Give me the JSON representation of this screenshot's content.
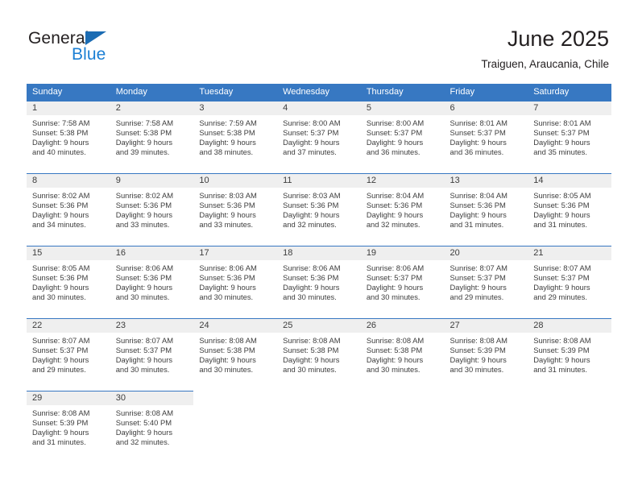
{
  "brand": {
    "name_part1": "General",
    "name_part2": "Blue",
    "triangle_icon": "triangle-icon",
    "colors": {
      "dark": "#231f20",
      "blue": "#1b7fd4",
      "triangle": "#1b6cb3"
    }
  },
  "header": {
    "title": "June 2025",
    "subtitle": "Traiguen, Araucania, Chile"
  },
  "calendar": {
    "accent_color": "#3778c2",
    "daynum_band_color": "#efefef",
    "weekdays": [
      "Sunday",
      "Monday",
      "Tuesday",
      "Wednesday",
      "Thursday",
      "Friday",
      "Saturday"
    ],
    "weeks": [
      [
        {
          "day": "1",
          "sunrise": "Sunrise: 7:58 AM",
          "sunset": "Sunset: 5:38 PM",
          "daylight1": "Daylight: 9 hours",
          "daylight2": "and 40 minutes."
        },
        {
          "day": "2",
          "sunrise": "Sunrise: 7:58 AM",
          "sunset": "Sunset: 5:38 PM",
          "daylight1": "Daylight: 9 hours",
          "daylight2": "and 39 minutes."
        },
        {
          "day": "3",
          "sunrise": "Sunrise: 7:59 AM",
          "sunset": "Sunset: 5:38 PM",
          "daylight1": "Daylight: 9 hours",
          "daylight2": "and 38 minutes."
        },
        {
          "day": "4",
          "sunrise": "Sunrise: 8:00 AM",
          "sunset": "Sunset: 5:37 PM",
          "daylight1": "Daylight: 9 hours",
          "daylight2": "and 37 minutes."
        },
        {
          "day": "5",
          "sunrise": "Sunrise: 8:00 AM",
          "sunset": "Sunset: 5:37 PM",
          "daylight1": "Daylight: 9 hours",
          "daylight2": "and 36 minutes."
        },
        {
          "day": "6",
          "sunrise": "Sunrise: 8:01 AM",
          "sunset": "Sunset: 5:37 PM",
          "daylight1": "Daylight: 9 hours",
          "daylight2": "and 36 minutes."
        },
        {
          "day": "7",
          "sunrise": "Sunrise: 8:01 AM",
          "sunset": "Sunset: 5:37 PM",
          "daylight1": "Daylight: 9 hours",
          "daylight2": "and 35 minutes."
        }
      ],
      [
        {
          "day": "8",
          "sunrise": "Sunrise: 8:02 AM",
          "sunset": "Sunset: 5:36 PM",
          "daylight1": "Daylight: 9 hours",
          "daylight2": "and 34 minutes."
        },
        {
          "day": "9",
          "sunrise": "Sunrise: 8:02 AM",
          "sunset": "Sunset: 5:36 PM",
          "daylight1": "Daylight: 9 hours",
          "daylight2": "and 33 minutes."
        },
        {
          "day": "10",
          "sunrise": "Sunrise: 8:03 AM",
          "sunset": "Sunset: 5:36 PM",
          "daylight1": "Daylight: 9 hours",
          "daylight2": "and 33 minutes."
        },
        {
          "day": "11",
          "sunrise": "Sunrise: 8:03 AM",
          "sunset": "Sunset: 5:36 PM",
          "daylight1": "Daylight: 9 hours",
          "daylight2": "and 32 minutes."
        },
        {
          "day": "12",
          "sunrise": "Sunrise: 8:04 AM",
          "sunset": "Sunset: 5:36 PM",
          "daylight1": "Daylight: 9 hours",
          "daylight2": "and 32 minutes."
        },
        {
          "day": "13",
          "sunrise": "Sunrise: 8:04 AM",
          "sunset": "Sunset: 5:36 PM",
          "daylight1": "Daylight: 9 hours",
          "daylight2": "and 31 minutes."
        },
        {
          "day": "14",
          "sunrise": "Sunrise: 8:05 AM",
          "sunset": "Sunset: 5:36 PM",
          "daylight1": "Daylight: 9 hours",
          "daylight2": "and 31 minutes."
        }
      ],
      [
        {
          "day": "15",
          "sunrise": "Sunrise: 8:05 AM",
          "sunset": "Sunset: 5:36 PM",
          "daylight1": "Daylight: 9 hours",
          "daylight2": "and 30 minutes."
        },
        {
          "day": "16",
          "sunrise": "Sunrise: 8:06 AM",
          "sunset": "Sunset: 5:36 PM",
          "daylight1": "Daylight: 9 hours",
          "daylight2": "and 30 minutes."
        },
        {
          "day": "17",
          "sunrise": "Sunrise: 8:06 AM",
          "sunset": "Sunset: 5:36 PM",
          "daylight1": "Daylight: 9 hours",
          "daylight2": "and 30 minutes."
        },
        {
          "day": "18",
          "sunrise": "Sunrise: 8:06 AM",
          "sunset": "Sunset: 5:36 PM",
          "daylight1": "Daylight: 9 hours",
          "daylight2": "and 30 minutes."
        },
        {
          "day": "19",
          "sunrise": "Sunrise: 8:06 AM",
          "sunset": "Sunset: 5:37 PM",
          "daylight1": "Daylight: 9 hours",
          "daylight2": "and 30 minutes."
        },
        {
          "day": "20",
          "sunrise": "Sunrise: 8:07 AM",
          "sunset": "Sunset: 5:37 PM",
          "daylight1": "Daylight: 9 hours",
          "daylight2": "and 29 minutes."
        },
        {
          "day": "21",
          "sunrise": "Sunrise: 8:07 AM",
          "sunset": "Sunset: 5:37 PM",
          "daylight1": "Daylight: 9 hours",
          "daylight2": "and 29 minutes."
        }
      ],
      [
        {
          "day": "22",
          "sunrise": "Sunrise: 8:07 AM",
          "sunset": "Sunset: 5:37 PM",
          "daylight1": "Daylight: 9 hours",
          "daylight2": "and 29 minutes."
        },
        {
          "day": "23",
          "sunrise": "Sunrise: 8:07 AM",
          "sunset": "Sunset: 5:37 PM",
          "daylight1": "Daylight: 9 hours",
          "daylight2": "and 30 minutes."
        },
        {
          "day": "24",
          "sunrise": "Sunrise: 8:08 AM",
          "sunset": "Sunset: 5:38 PM",
          "daylight1": "Daylight: 9 hours",
          "daylight2": "and 30 minutes."
        },
        {
          "day": "25",
          "sunrise": "Sunrise: 8:08 AM",
          "sunset": "Sunset: 5:38 PM",
          "daylight1": "Daylight: 9 hours",
          "daylight2": "and 30 minutes."
        },
        {
          "day": "26",
          "sunrise": "Sunrise: 8:08 AM",
          "sunset": "Sunset: 5:38 PM",
          "daylight1": "Daylight: 9 hours",
          "daylight2": "and 30 minutes."
        },
        {
          "day": "27",
          "sunrise": "Sunrise: 8:08 AM",
          "sunset": "Sunset: 5:39 PM",
          "daylight1": "Daylight: 9 hours",
          "daylight2": "and 30 minutes."
        },
        {
          "day": "28",
          "sunrise": "Sunrise: 8:08 AM",
          "sunset": "Sunset: 5:39 PM",
          "daylight1": "Daylight: 9 hours",
          "daylight2": "and 31 minutes."
        }
      ],
      [
        {
          "day": "29",
          "sunrise": "Sunrise: 8:08 AM",
          "sunset": "Sunset: 5:39 PM",
          "daylight1": "Daylight: 9 hours",
          "daylight2": "and 31 minutes."
        },
        {
          "day": "30",
          "sunrise": "Sunrise: 8:08 AM",
          "sunset": "Sunset: 5:40 PM",
          "daylight1": "Daylight: 9 hours",
          "daylight2": "and 32 minutes."
        },
        {
          "day": "",
          "sunrise": "",
          "sunset": "",
          "daylight1": "",
          "daylight2": ""
        },
        {
          "day": "",
          "sunrise": "",
          "sunset": "",
          "daylight1": "",
          "daylight2": ""
        },
        {
          "day": "",
          "sunrise": "",
          "sunset": "",
          "daylight1": "",
          "daylight2": ""
        },
        {
          "day": "",
          "sunrise": "",
          "sunset": "",
          "daylight1": "",
          "daylight2": ""
        },
        {
          "day": "",
          "sunrise": "",
          "sunset": "",
          "daylight1": "",
          "daylight2": ""
        }
      ]
    ]
  }
}
